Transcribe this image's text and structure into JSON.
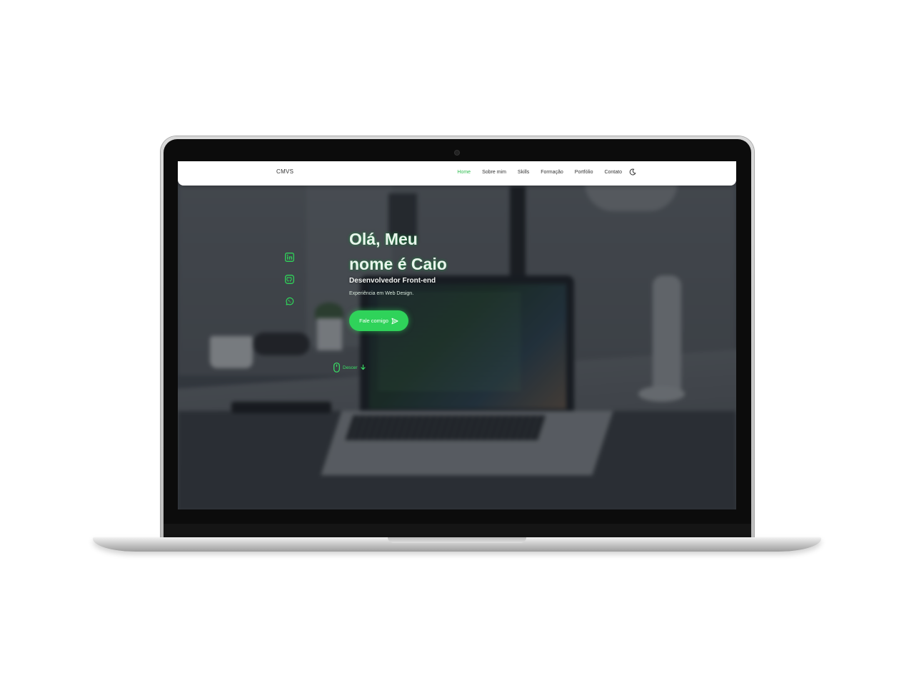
{
  "colors": {
    "accent": "#2fd35a",
    "accent_text": "#39e266",
    "header_bg": "#ffffff"
  },
  "site": {
    "logo": "CMVS",
    "nav": [
      {
        "label": "Home",
        "active": true
      },
      {
        "label": "Sobre mim",
        "active": false
      },
      {
        "label": "Skills",
        "active": false
      },
      {
        "label": "Formação",
        "active": false
      },
      {
        "label": "Portfólio",
        "active": false
      },
      {
        "label": "Contato",
        "active": false
      }
    ],
    "theme_toggle_icon": "moon-icon"
  },
  "hero": {
    "title_line1": "Olá, Meu",
    "title_line2": "nome é Caio",
    "subtitle": "Desenvolvedor Front-end",
    "description": "Experiência em Web Design.",
    "cta_label": "Fale comigo",
    "cta_icon": "send-icon",
    "social_icons": [
      "linkedin-icon",
      "github-icon",
      "whatsapp-icon"
    ],
    "scroll_label": "Descer",
    "scroll_icons": [
      "mouse-icon",
      "arrow-down-icon"
    ]
  }
}
